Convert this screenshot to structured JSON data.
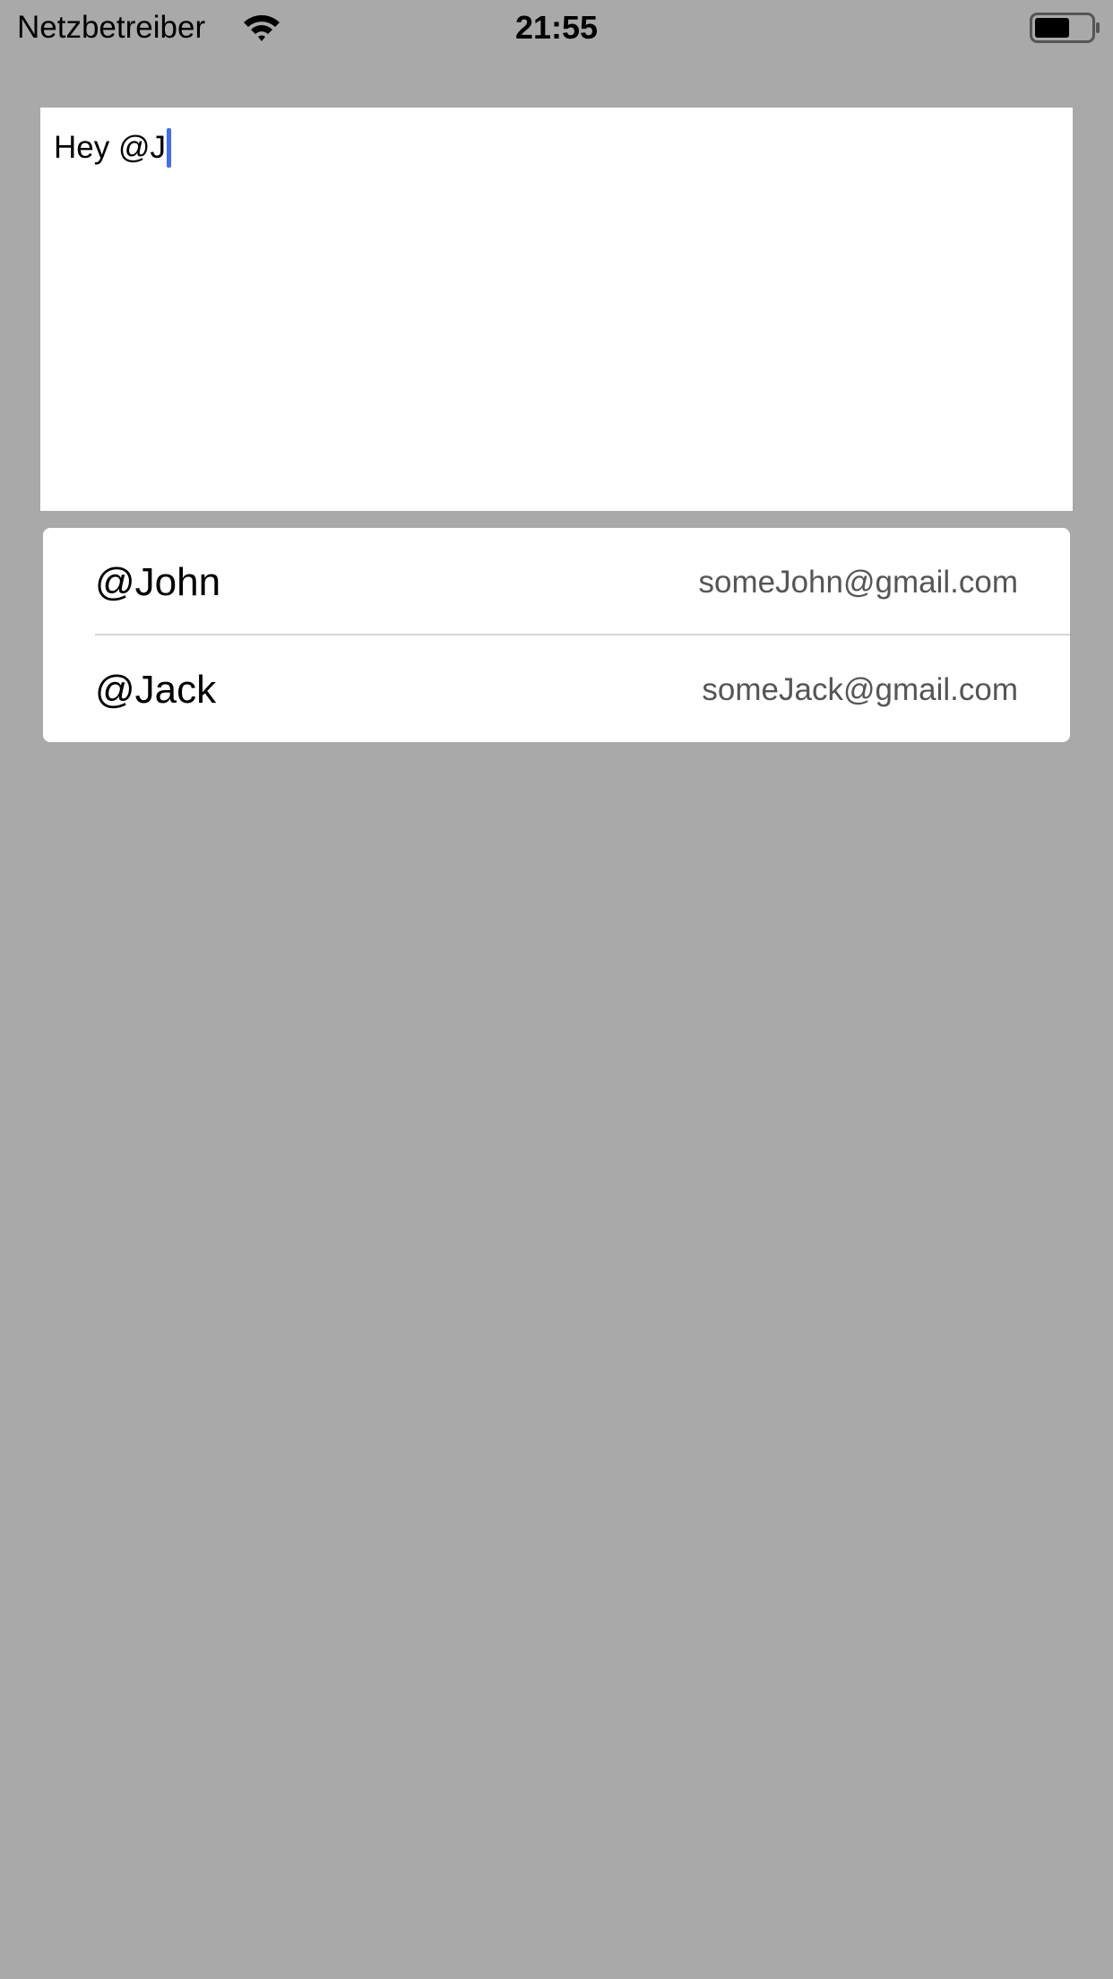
{
  "status_bar": {
    "carrier": "Netzbetreiber",
    "time": "21:55",
    "wifi_icon": "wifi-icon",
    "battery_icon": "battery-icon"
  },
  "text_view": {
    "value": "Hey @J",
    "caret_color": "#3f6df3"
  },
  "suggestions": [
    {
      "name": "@John",
      "email": "someJohn@gmail.com"
    },
    {
      "name": "@Jack",
      "email": "someJack@gmail.com"
    }
  ],
  "colors": {
    "background": "#a9a9a9",
    "surface": "#ffffff",
    "secondary_text": "#555555"
  }
}
